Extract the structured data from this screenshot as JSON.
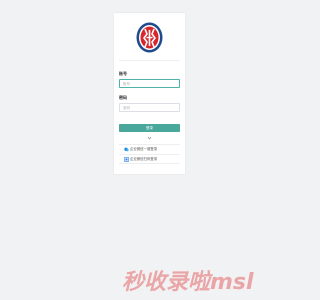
{
  "login": {
    "username": {
      "label": "账号",
      "placeholder": "账号"
    },
    "password": {
      "label": "密码",
      "placeholder": "密码"
    },
    "submit_label": "登录",
    "alt_logins": [
      {
        "label": "企业微信一键登录",
        "icon": "wecom-icon"
      },
      {
        "label": "企业微信扫码登录",
        "icon": "qrcode-icon"
      }
    ]
  },
  "watermark": "秒收录啦msl",
  "colors": {
    "accent": "#4aa79c",
    "logo_red": "#d7262c",
    "logo_blue": "#1f4a8c",
    "watermark": "#e56767"
  }
}
